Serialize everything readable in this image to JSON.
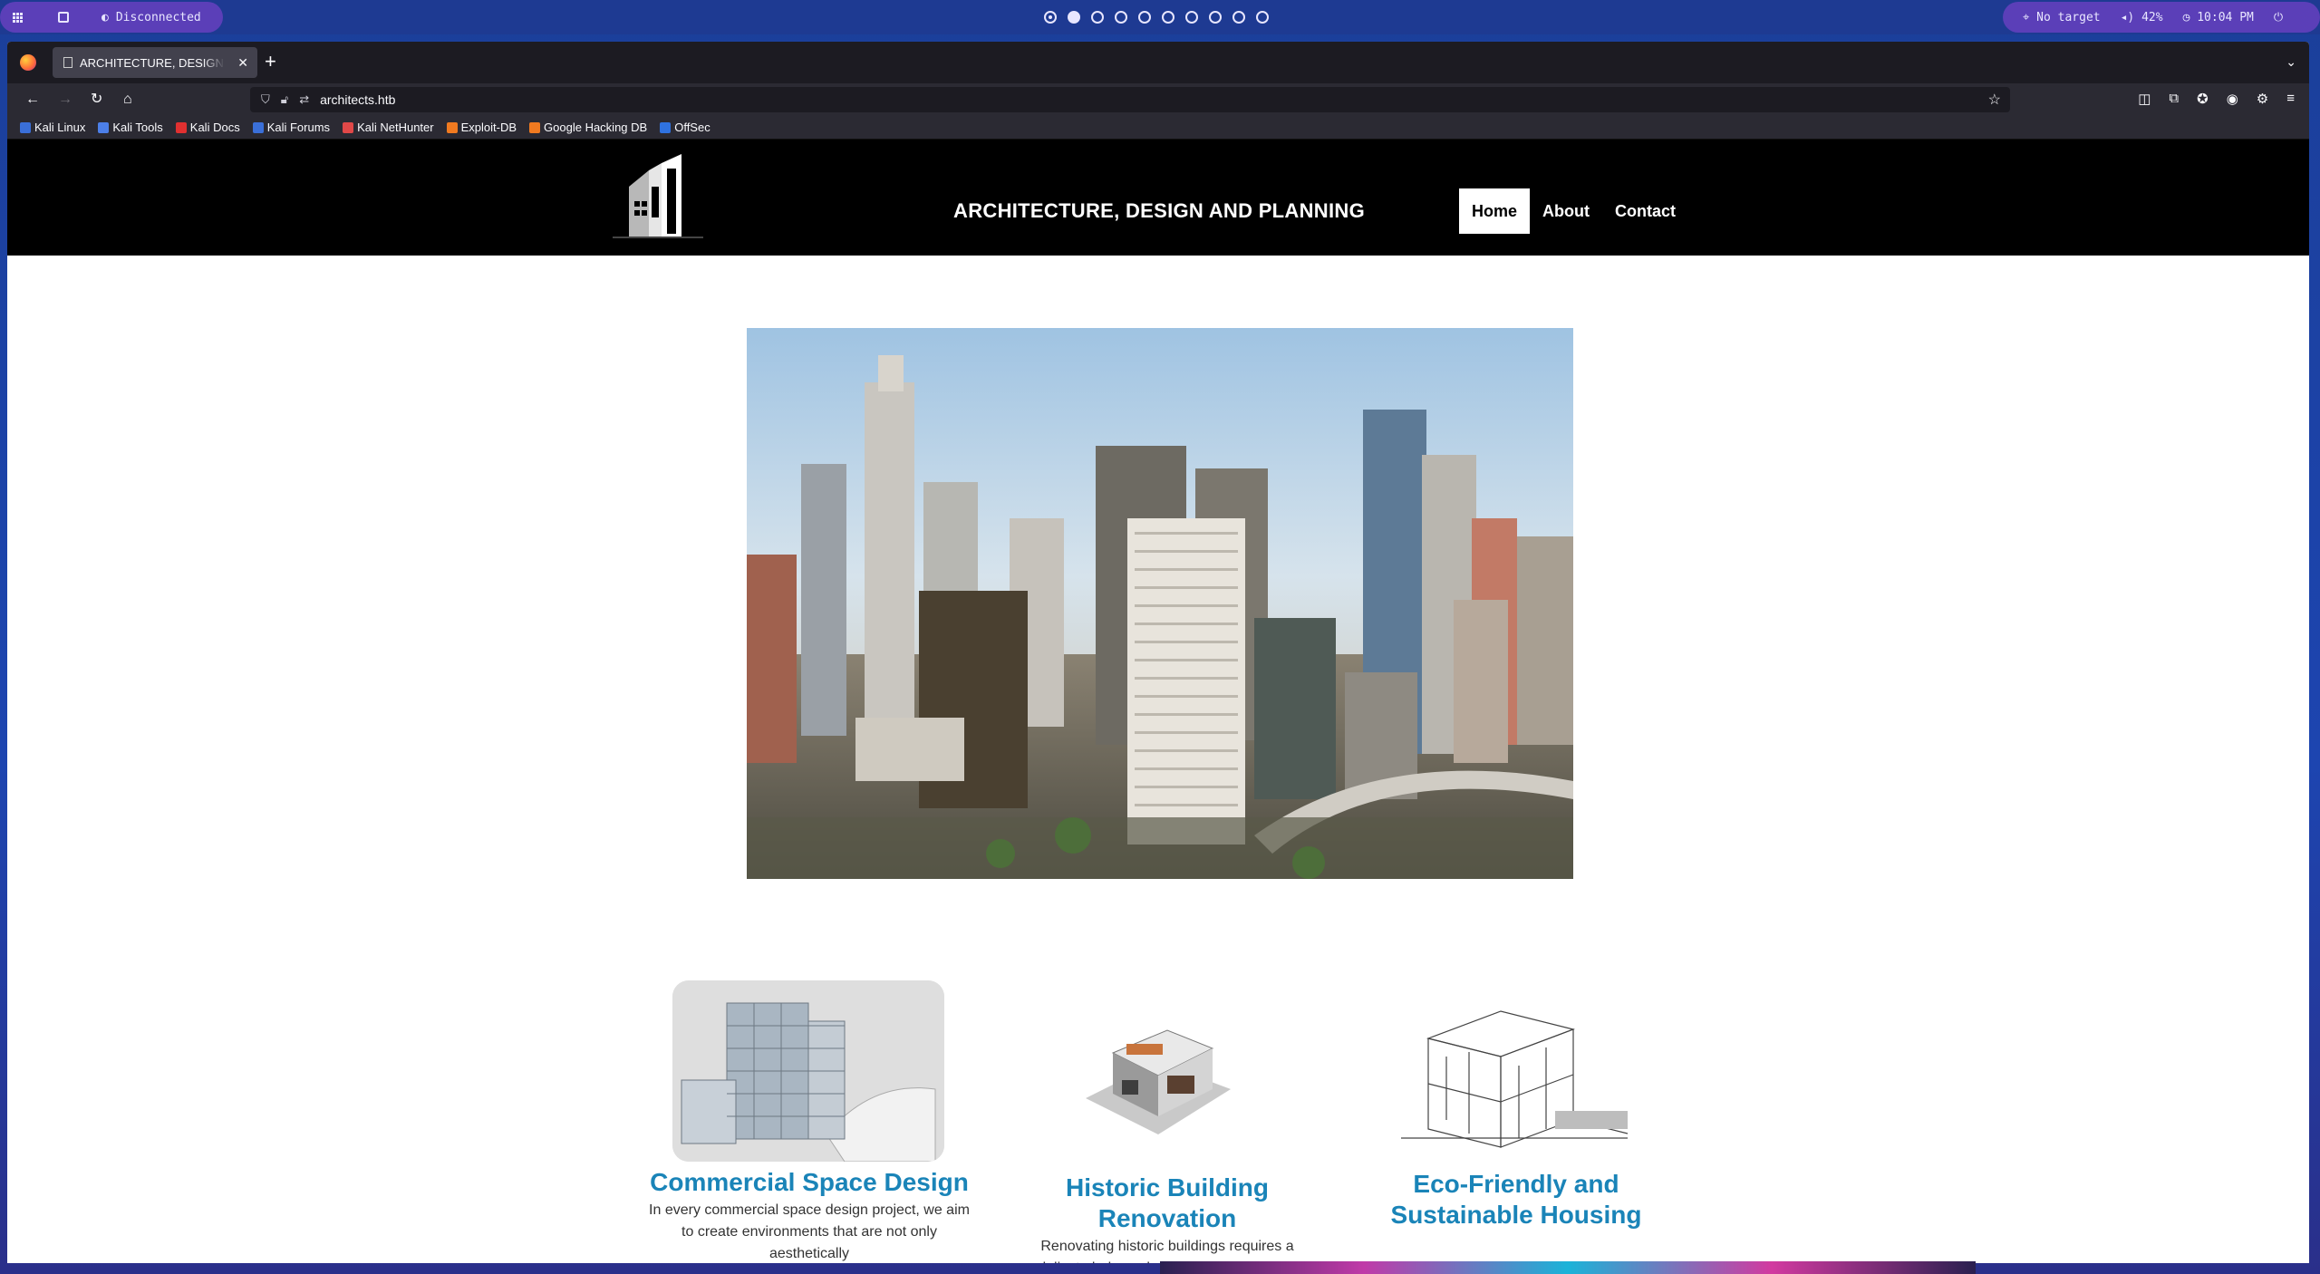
{
  "system_bar": {
    "status": "Disconnected",
    "target": "No target",
    "volume": "42%",
    "clock": "10:04 PM",
    "workspace_count": 10,
    "active_workspace": 2
  },
  "browser": {
    "tab_title": "ARCHITECTURE, DESIGN AND PLANNING",
    "url": "architects.htb",
    "bookmarks": [
      {
        "label": "Kali Linux",
        "color": "#3a6fd8"
      },
      {
        "label": "Kali Tools",
        "color": "#4c7fe8"
      },
      {
        "label": "Kali Docs",
        "color": "#e03030"
      },
      {
        "label": "Kali Forums",
        "color": "#3a6fd8"
      },
      {
        "label": "Kali NetHunter",
        "color": "#e04848"
      },
      {
        "label": "Exploit-DB",
        "color": "#f07a20"
      },
      {
        "label": "Google Hacking DB",
        "color": "#f07a20"
      },
      {
        "label": "OffSec",
        "color": "#2f72e0"
      }
    ]
  },
  "site": {
    "title": "ARCHITECTURE, DESIGN AND PLANNING",
    "nav": [
      {
        "label": "Home",
        "active": true
      },
      {
        "label": "About",
        "active": false
      },
      {
        "label": "Contact",
        "active": false
      }
    ],
    "services": [
      {
        "title": "Commercial Space Design",
        "text": "In every commercial space design project, we aim to create environments that are not only aesthetically"
      },
      {
        "title": "Historic Building Renovation",
        "text": "Renovating historic buildings requires a delicate balance between respecting the"
      },
      {
        "title": "Eco-Friendly and Sustainable Housing",
        "text": ""
      }
    ]
  },
  "colors": {
    "accent": "#1a84b8",
    "header_bg": "#000000",
    "panel_pill": "#5b3fb8"
  }
}
